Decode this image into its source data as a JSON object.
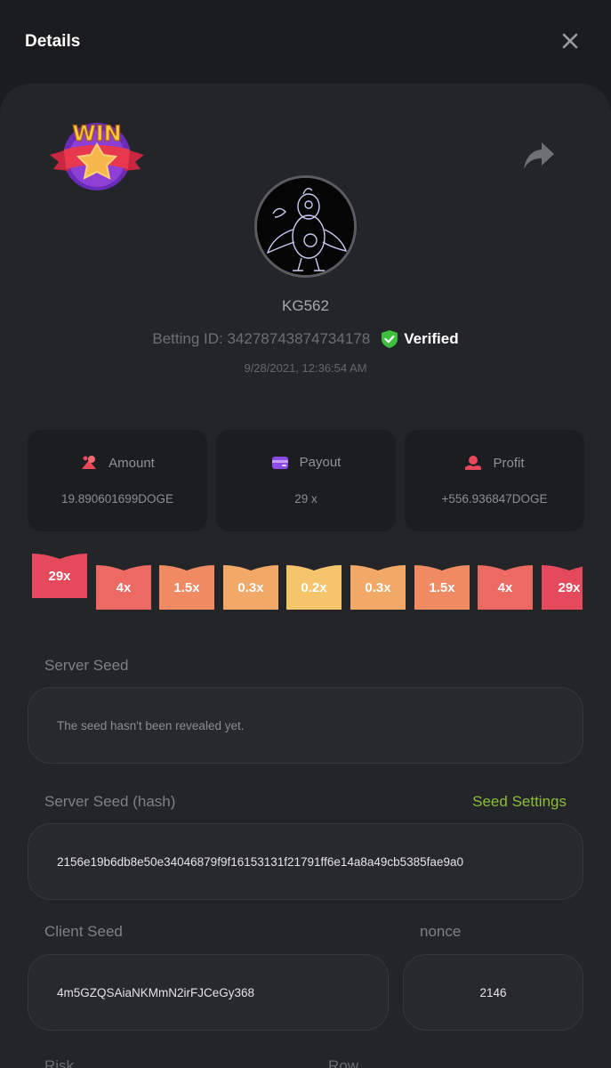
{
  "header": {
    "title": "Details"
  },
  "badge": {
    "text": "WIN"
  },
  "bet": {
    "username": "KG562",
    "betting_id": "Betting ID: 34278743874734178",
    "verified": "Verified",
    "datetime": "9/28/2021, 12:36:54 AM"
  },
  "stats": [
    {
      "label": "Amount",
      "value": "19.890601699DOGE",
      "icon": "coins-icon"
    },
    {
      "label": "Payout",
      "value": "29 x",
      "icon": "wallet-icon"
    },
    {
      "label": "Profit",
      "value": "+556.936847DOGE",
      "icon": "hand-coin-icon"
    }
  ],
  "multipliers": [
    "29x",
    "4x",
    "1.5x",
    "0.3x",
    "0.2x",
    "0.3x",
    "1.5x",
    "4x",
    "29x"
  ],
  "multiplier_colors": [
    "#e5495c",
    "#ed6a62",
    "#ef8a62",
    "#f2a866",
    "#f4c56b",
    "#f2a866",
    "#ef8a62",
    "#ed6a62",
    "#e5495c"
  ],
  "selected_multiplier": "29x",
  "server_seed": {
    "label": "Server Seed",
    "value": "The seed hasn't been revealed yet."
  },
  "server_seed_hash": {
    "label": "Server Seed (hash)",
    "link": "Seed Settings",
    "value": "2156e19b6db8e50e34046879f9f16153131f21791ff6e14a8a49cb5385fae9a0"
  },
  "client_seed": {
    "label": "Client Seed",
    "value": "4m5GZQSAiaNKMmN2irFJCeGy368"
  },
  "nonce": {
    "label": "nonce",
    "value": "2146"
  },
  "cut_off_labels": {
    "left": "Risk",
    "right": "Row"
  },
  "colors": {
    "accent_green": "#8cbe3c",
    "verified_green": "#3fbf3f",
    "panel": "#242528",
    "background": "#1b1c1e"
  }
}
